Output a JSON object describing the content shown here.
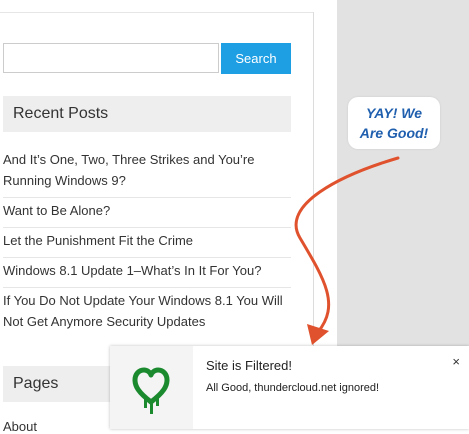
{
  "search": {
    "placeholder": "",
    "value": "",
    "button_label": "Search"
  },
  "recent_posts": {
    "title": "Recent Posts",
    "items": [
      {
        "text": "And It’s One, Two, Three Strikes and You’re Running Windows 9?"
      },
      {
        "text": "Want to Be Alone?"
      },
      {
        "text": "Let the Punishment Fit the Crime"
      },
      {
        "text": "Windows 8.1 Update 1–What’s In It For You?"
      },
      {
        "text": "If You Do Not Update Your Windows 8.1 You Will Not Get Anymore Security Updates"
      }
    ]
  },
  "pages": {
    "title": "Pages",
    "first_item": "About"
  },
  "callout": {
    "line1": "YAY! We",
    "line2": "Are Good!"
  },
  "notification": {
    "title": "Site is Filtered!",
    "message": "All Good, thundercloud.net ignored!",
    "close": "×",
    "icon": "bleeding-heart-icon"
  },
  "colors": {
    "search_button": "#1e9fe4",
    "callout_text": "#1f5fae",
    "arrow": "#e0522d",
    "heart_icon": "#1b8a2f",
    "sidebar_background": "#e2e2e2"
  }
}
